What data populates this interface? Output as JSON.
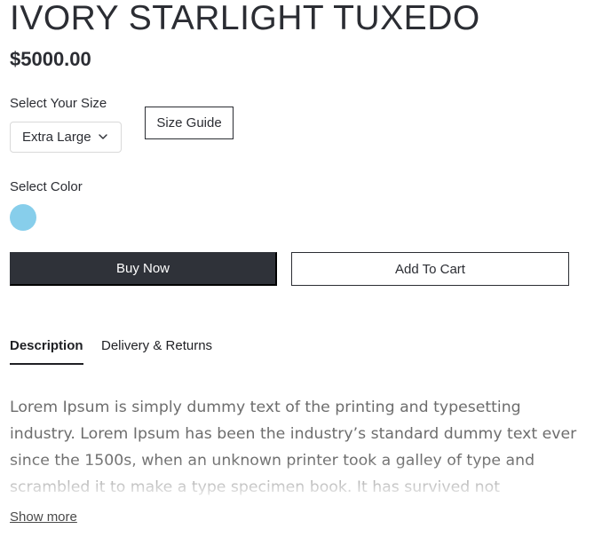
{
  "product": {
    "title": "IVORY STARLIGHT TUXEDO",
    "price": "$5000.00"
  },
  "size": {
    "label": "Select Your Size",
    "selected": "Extra Large",
    "guide_label": "Size Guide"
  },
  "color": {
    "label": "Select Color",
    "swatches": [
      {
        "hex": "#87ceeb"
      }
    ]
  },
  "actions": {
    "buy_now_label": "Buy Now",
    "add_to_cart_label": "Add To Cart"
  },
  "tabs": [
    {
      "label": "Description",
      "active": true
    },
    {
      "label": "Delivery & Returns",
      "active": false
    }
  ],
  "description": {
    "text": "Lorem Ipsum is simply dummy text of the printing and typesetting industry. Lorem Ipsum has been the industry’s standard dummy text ever since the 1500s, when an unknown printer took a galley of type and scrambled it to make a type specimen book. It has survived not",
    "show_more_label": "Show more"
  },
  "icons": {
    "size_dropdown": "chevron-down-icon"
  },
  "colors": {
    "primary_dark": "#2f3239",
    "text": "#2b2d33",
    "muted_text": "#6d6d6d",
    "border_light": "#d9d9d9"
  }
}
